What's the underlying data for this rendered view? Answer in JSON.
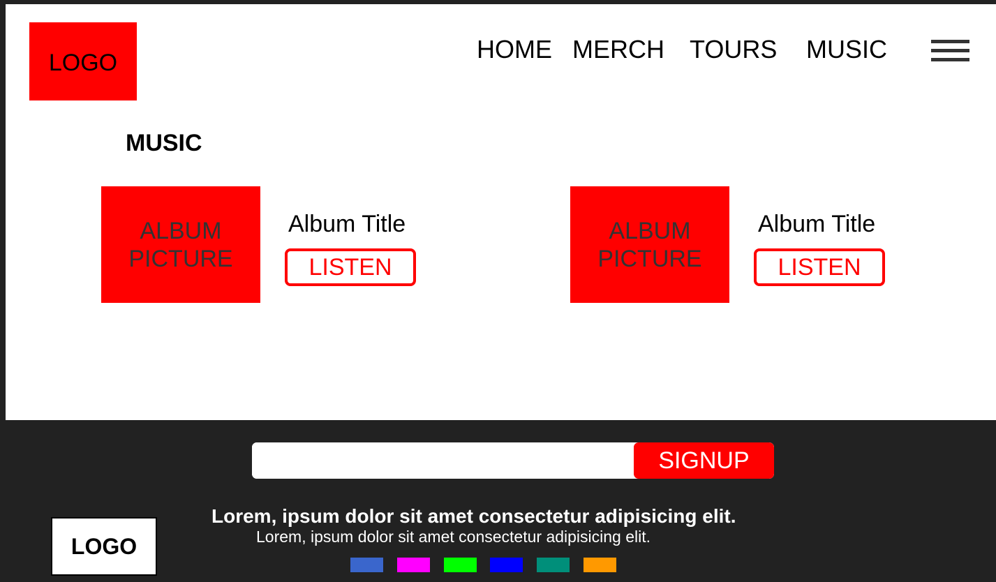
{
  "header": {
    "logo_label": "LOGO",
    "nav": [
      "HOME",
      "MERCH",
      "TOURS",
      "MUSIC"
    ],
    "menu_icon": "hamburger-menu-icon"
  },
  "main": {
    "heading": "MUSIC",
    "albums": [
      {
        "picture_label_line1": "ALBUM",
        "picture_label_line2": "PICTURE",
        "title": "Album Title",
        "button_label": "LISTEN"
      },
      {
        "picture_label_line1": "ALBUM",
        "picture_label_line2": "PICTURE",
        "title": "Album Title",
        "button_label": "LISTEN"
      }
    ]
  },
  "footer": {
    "signup": {
      "input_value": "",
      "button_label": "SIGNUP"
    },
    "logo_label": "LOGO",
    "text_bold": "Lorem, ipsum dolor sit amet consectetur adipisicing elit.",
    "text": "Lorem, ipsum dolor sit amet consectetur adipisicing elit.",
    "social_colors": [
      "#3a66cc",
      "#ff00ff",
      "#00ff00",
      "#0000ff",
      "#008f7a",
      "#ff9900"
    ]
  },
  "colors": {
    "accent": "#ff0000",
    "footer_bg": "#222222",
    "page_bg": "#ffffff"
  }
}
